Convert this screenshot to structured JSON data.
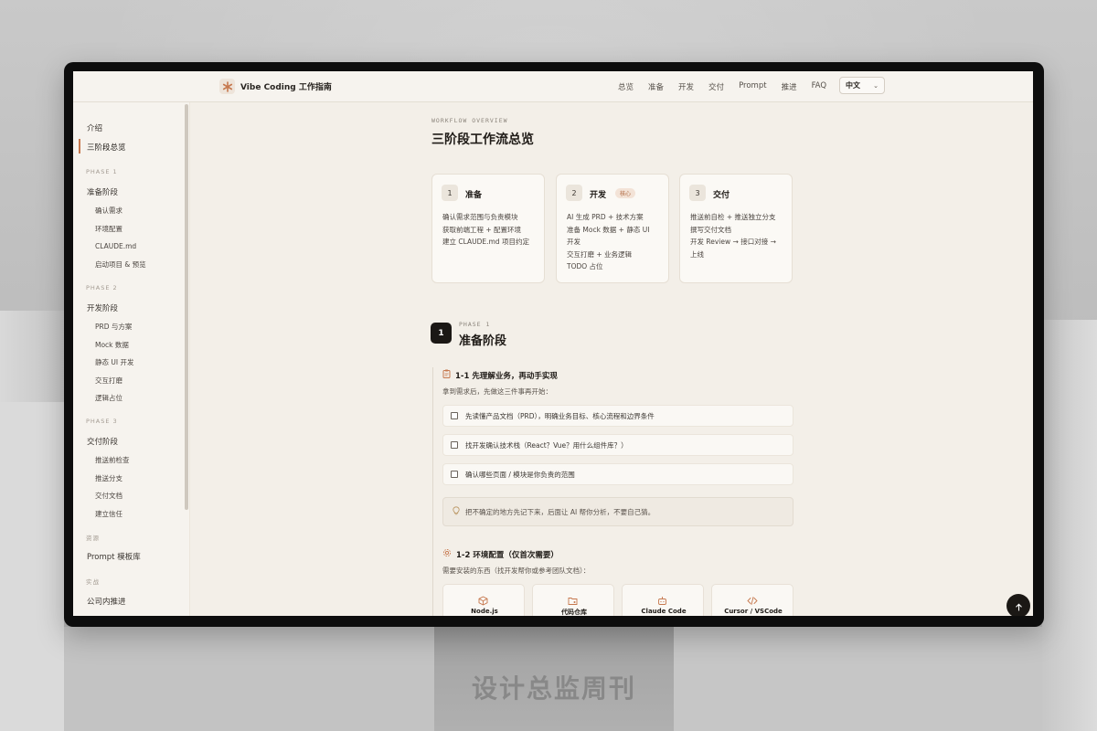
{
  "app": {
    "title": "Vibe Coding 工作指南"
  },
  "nav": {
    "items": [
      "总览",
      "准备",
      "开发",
      "交付",
      "Prompt",
      "推进",
      "FAQ"
    ],
    "language": "中文"
  },
  "sidebar": {
    "intro": "介绍",
    "overview": "三阶段总览",
    "phase1": {
      "group": "PHASE 1",
      "title": "准备阶段",
      "items": [
        "确认需求",
        "环境配置",
        "CLAUDE.md",
        "启动项目 & 预览"
      ]
    },
    "phase2": {
      "group": "PHASE 2",
      "title": "开发阶段",
      "items": [
        "PRD 与方案",
        "Mock 数据",
        "静态 UI 开发",
        "交互打磨",
        "逻辑占位"
      ]
    },
    "phase3": {
      "group": "PHASE 3",
      "title": "交付阶段",
      "items": [
        "推送前检查",
        "推送分支",
        "交付文档",
        "建立信任"
      ]
    },
    "resources": {
      "group": "资源",
      "items": [
        "Prompt 模板库"
      ]
    },
    "practice": {
      "group": "实战",
      "items": [
        "公司内推进"
      ]
    }
  },
  "main": {
    "eyebrow": "WORKFLOW OVERVIEW",
    "title": "三阶段工作流总览",
    "cards": [
      {
        "num": "1",
        "title": "准备",
        "badge": "",
        "lines": [
          "确认需求范围与负责模块",
          "获取前端工程 + 配置环境",
          "建立 CLAUDE.md 项目约定"
        ]
      },
      {
        "num": "2",
        "title": "开发",
        "badge": "核心",
        "lines": [
          "AI 生成 PRD + 技术方案",
          "准备 Mock 数据 + 静态 UI",
          "开发",
          "交互打磨 + 业务逻辑",
          "TODO 占位"
        ]
      },
      {
        "num": "3",
        "title": "交付",
        "badge": "",
        "lines": [
          "推送前自检 + 推送独立分支",
          "撰写交付文档",
          "开发 Review → 接口对接 →",
          "上线"
        ]
      }
    ],
    "phase": {
      "num": "1",
      "eyebrow": "PHASE 1",
      "title": "准备阶段"
    },
    "section1": {
      "title": "1-1 先理解业务，再动手实现",
      "sub": "拿到需求后，先做这三件事再开始：",
      "checks": [
        "先读懂产品文档（PRD），明确业务目标、核心流程和边界条件",
        "找开发确认技术栈（React？Vue？用什么组件库？）",
        "确认哪些页面 / 模块是你负责的范围"
      ],
      "tip": "把不确定的地方先记下来，后面让 AI 帮你分析，不要自己猜。"
    },
    "section2": {
      "title": "1-2 环境配置（仅首次需要）",
      "sub": "需要安装的东西（找开发帮你或参考团队文档）：",
      "tools": [
        "Node.js",
        "代码仓库",
        "Claude Code",
        "Cursor / VSCode"
      ]
    }
  },
  "background": {
    "stand_text": "设计总监周刊"
  },
  "colors": {
    "accent": "#c6784e",
    "bg": "#f3efe8",
    "dark": "#1b1815"
  }
}
